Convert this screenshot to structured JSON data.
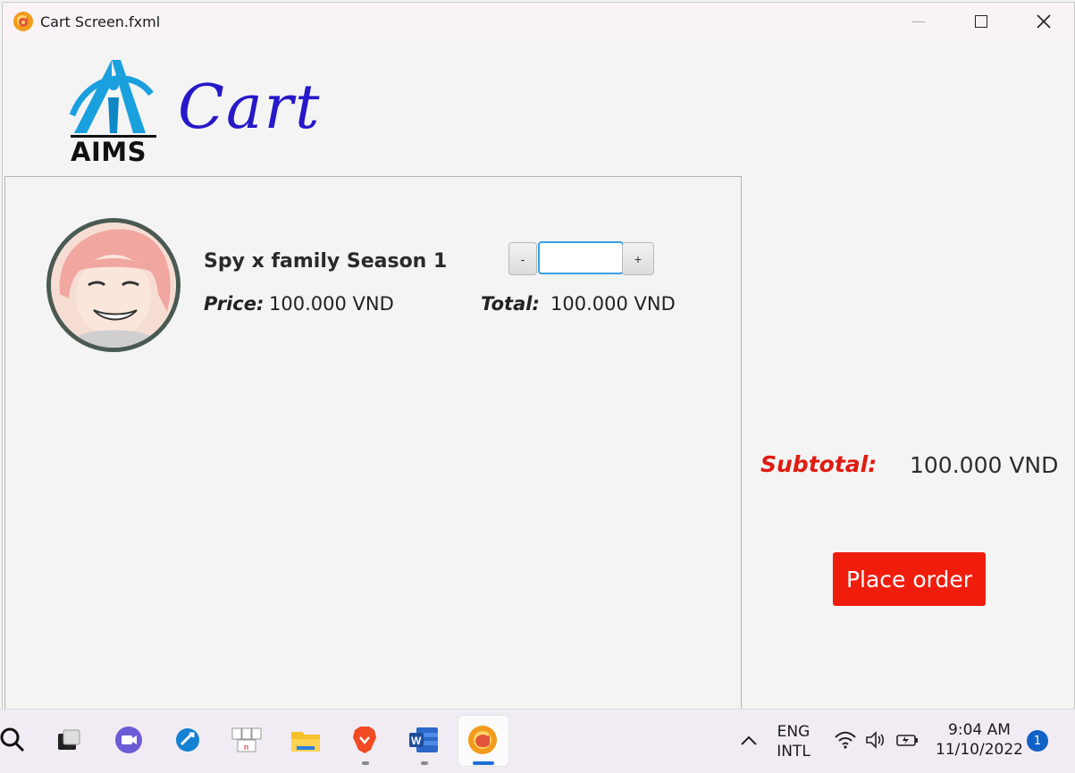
{
  "window": {
    "title": "Cart Screen.fxml",
    "controls": {
      "minimize": "minimize-icon",
      "maximize": "maximize-icon",
      "close": "close-icon"
    }
  },
  "header": {
    "logo_text": "AIMS",
    "page_title": "Cart"
  },
  "cart": {
    "items": [
      {
        "title": "Spy x family Season 1",
        "price_label": "Price:",
        "price_value": "100.000 VND",
        "total_label": "Total:",
        "total_value": "100.000 VND",
        "quantity_value": "",
        "decrement_label": "-",
        "increment_label": "+"
      }
    ]
  },
  "summary": {
    "subtotal_label": "Subtotal:",
    "subtotal_value": "100.000 VND",
    "place_order_label": "Place order"
  },
  "taskbar": {
    "apps": [
      "search-icon",
      "task-view-icon",
      "meet-icon",
      "remote-icon",
      "keyboard-tool-icon",
      "file-explorer-icon",
      "brave-icon",
      "word-icon",
      "active-app-icon"
    ],
    "language_line1": "ENG",
    "language_line2": "INTL",
    "time": "9:04 AM",
    "date": "11/10/2022",
    "notification_count": "1"
  },
  "colors": {
    "accent_red": "#f01d0d",
    "title_blue": "#2718c9",
    "focus_blue": "#3aa0e8"
  }
}
